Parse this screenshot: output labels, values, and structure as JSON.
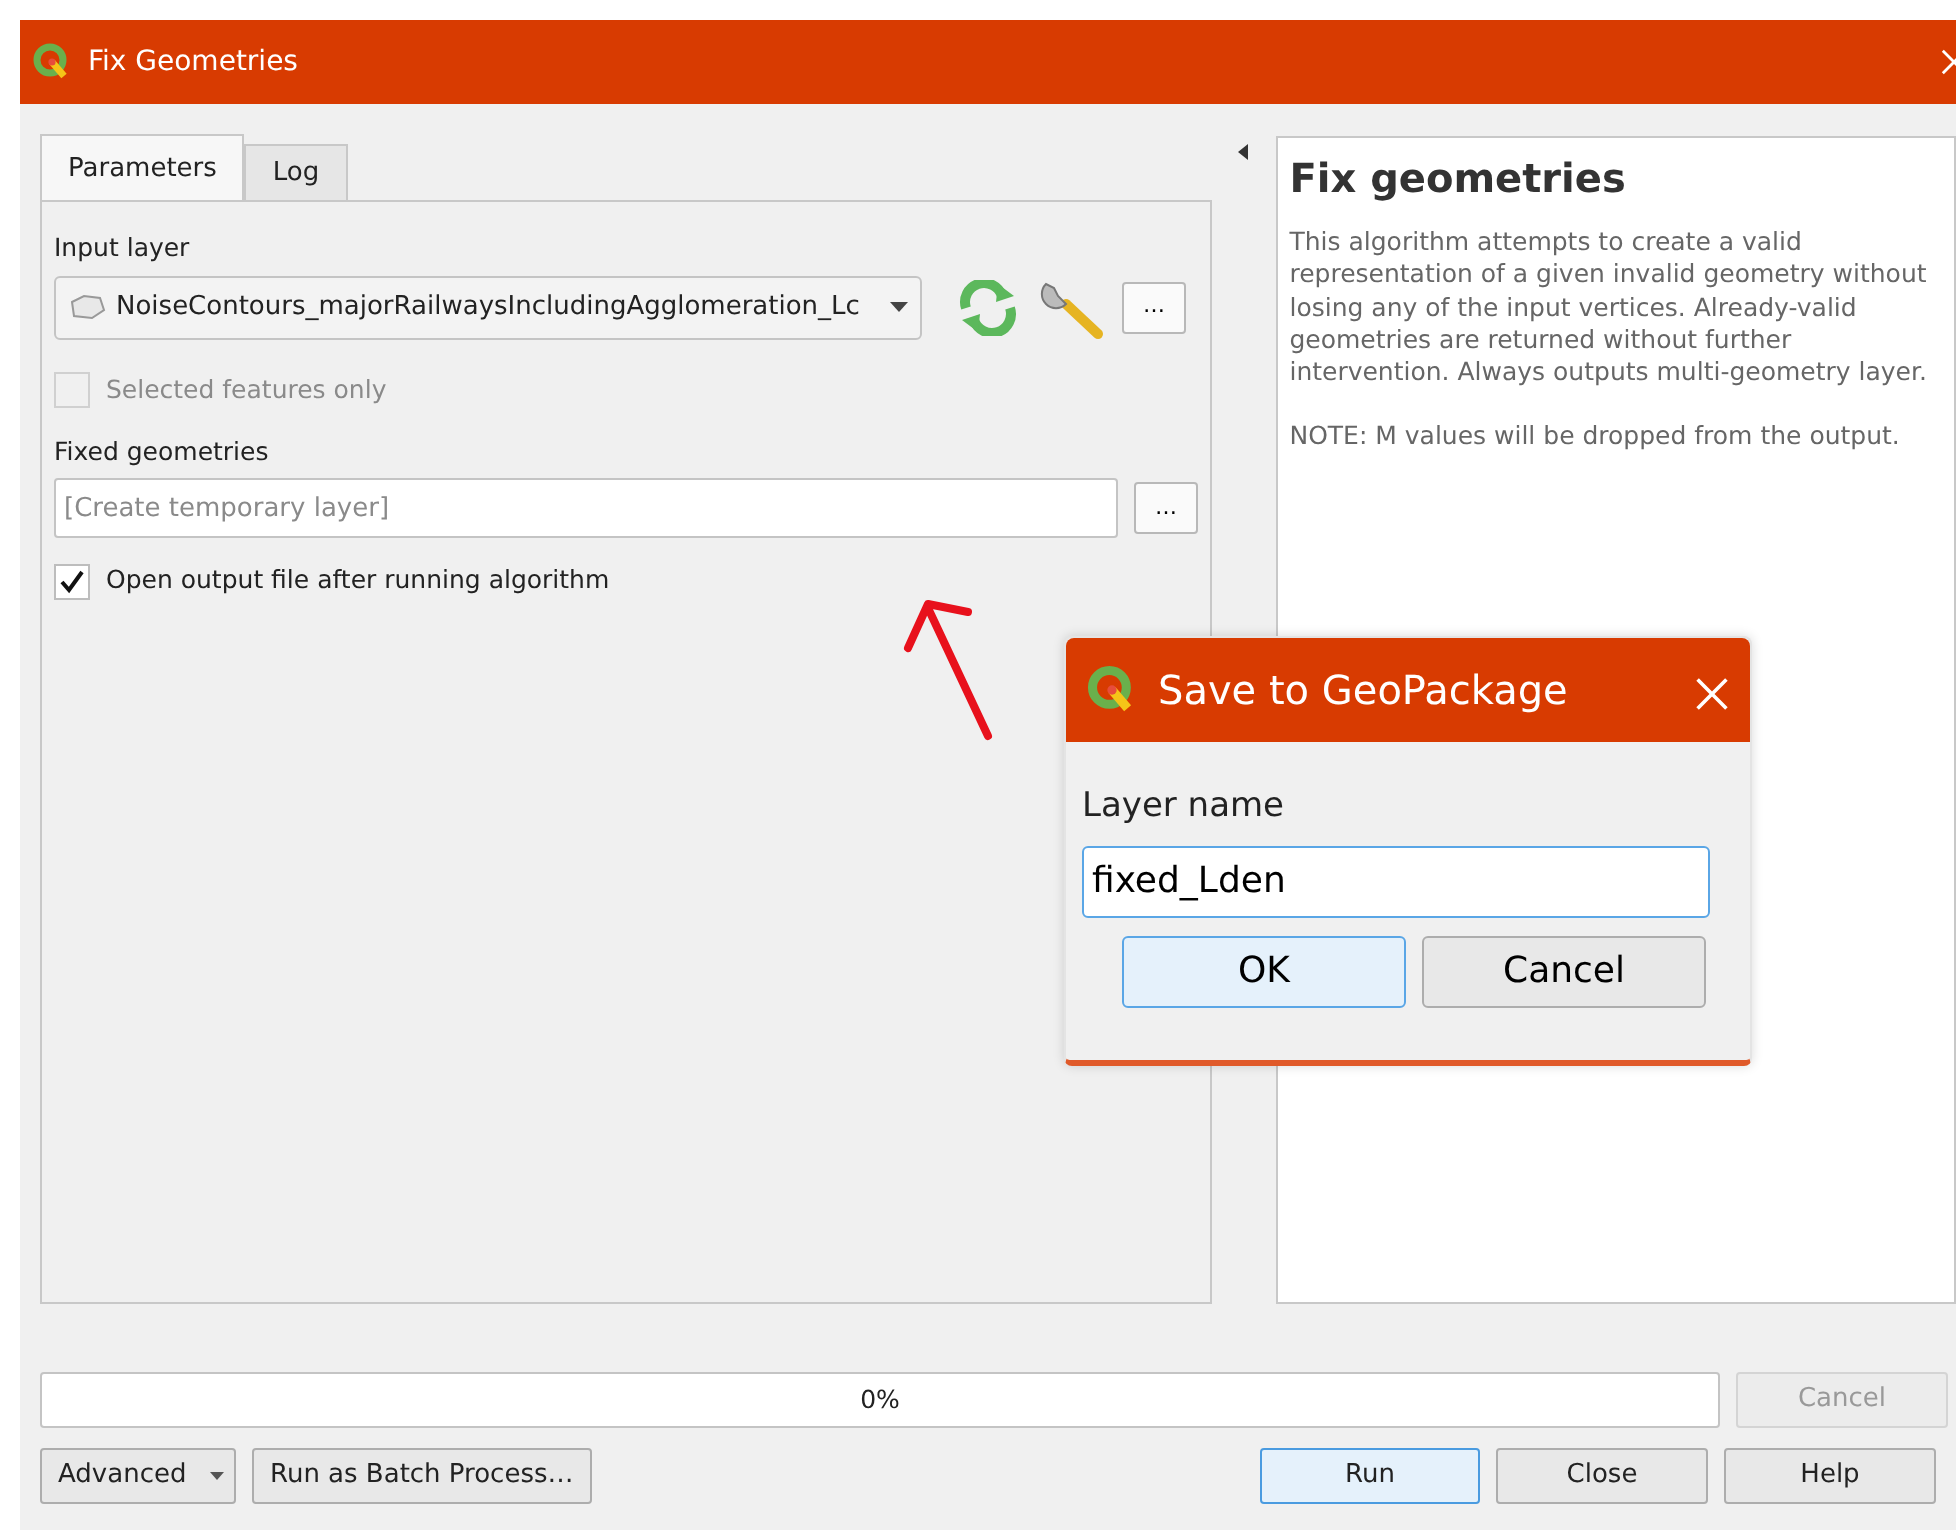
{
  "window": {
    "title": "Fix Geometries"
  },
  "tabs": [
    {
      "label": "Parameters",
      "selected": true
    },
    {
      "label": "Log",
      "selected": false
    }
  ],
  "parameters": [
    {
      "kind": "layer",
      "label": "Input layer",
      "value": "NoiseContours_majorRailwaysIncludingAgglomeration_Lc",
      "browse": "…"
    },
    {
      "kind": "checkbox",
      "label": "Selected features only",
      "checked": false,
      "disabled": true
    },
    {
      "kind": "output",
      "label": "Fixed geometries",
      "placeholder": "[Create temporary layer]",
      "browse": "…"
    },
    {
      "kind": "checkbox",
      "label": "Open output file after running algorithm",
      "checked": true,
      "disabled": false
    }
  ],
  "help": {
    "title": "Fix geometries",
    "paragraphs": [
      "This algorithm attempts to create a valid representation of a given invalid geometry without losing any of the input vertices. Already-valid geometries are returned without further intervention. Always outputs multi-geometry layer.",
      "NOTE: M values will be dropped from the output."
    ]
  },
  "progress": {
    "level": 0,
    "reading": "0%",
    "cancel": {
      "label": "Cancel",
      "disabled": true
    }
  },
  "buttons": [
    {
      "label": "Advanced",
      "kind": "dropdown"
    },
    {
      "label": "Run as Batch Process…",
      "kind": "plain"
    },
    {
      "label": "Run",
      "kind": "default"
    },
    {
      "label": "Close",
      "kind": "plain"
    },
    {
      "label": "Help",
      "kind": "plain"
    }
  ],
  "dialog": {
    "title": "Save to GeoPackage",
    "field_label": "Layer name",
    "value": "fixed_Lden",
    "buttons": [
      {
        "label": "OK",
        "kind": "default"
      },
      {
        "label": "Cancel",
        "kind": "plain"
      }
    ]
  }
}
